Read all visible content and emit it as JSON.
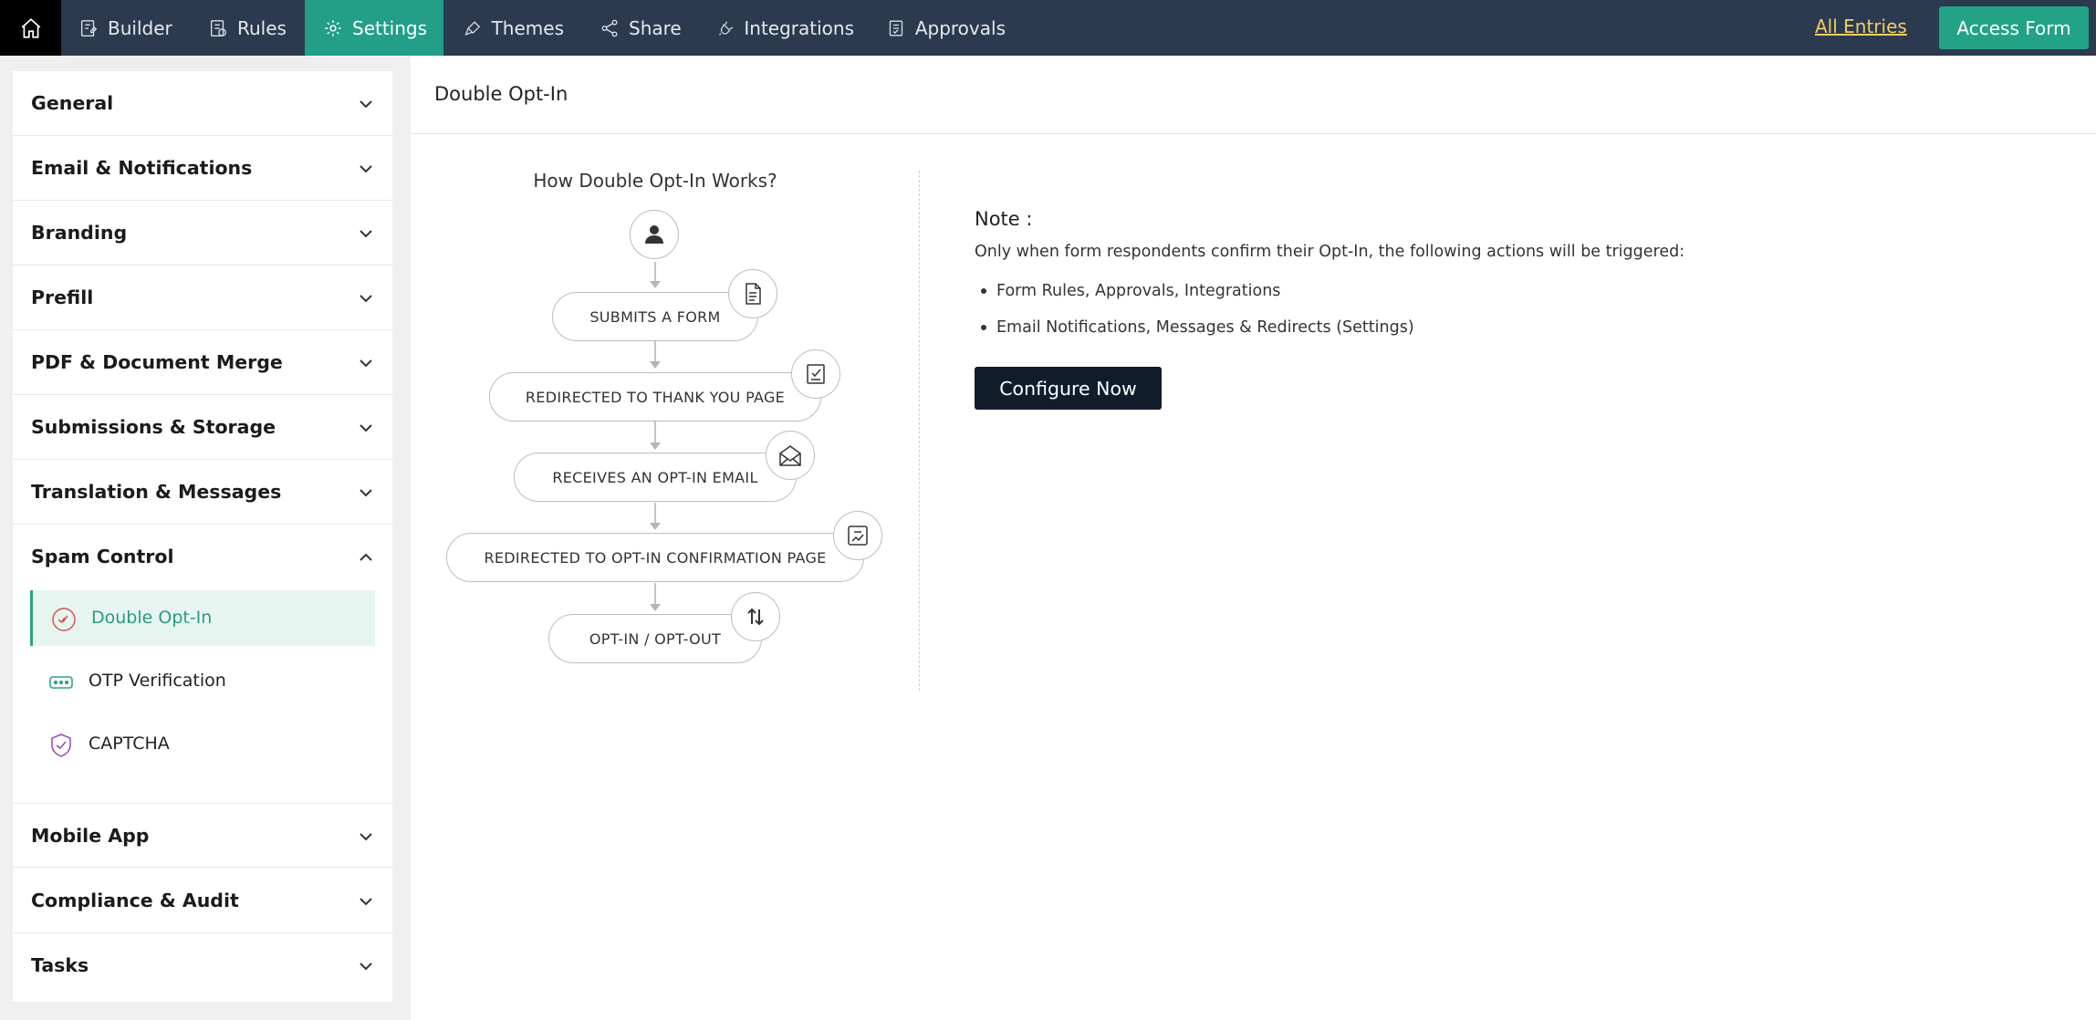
{
  "topbar": {
    "tabs": [
      {
        "label": "Builder",
        "icon": "builder-icon"
      },
      {
        "label": "Rules",
        "icon": "rules-icon"
      },
      {
        "label": "Settings",
        "icon": "gear-icon",
        "active": true
      },
      {
        "label": "Themes",
        "icon": "brush-icon"
      },
      {
        "label": "Share",
        "icon": "share-icon"
      },
      {
        "label": "Integrations",
        "icon": "plug-icon"
      },
      {
        "label": "Approvals",
        "icon": "approvals-icon"
      }
    ],
    "all_entries": "All Entries",
    "access_form": "Access Form"
  },
  "sidebar": {
    "sections": [
      {
        "label": "General"
      },
      {
        "label": "Email & Notifications"
      },
      {
        "label": "Branding"
      },
      {
        "label": "Prefill"
      },
      {
        "label": "PDF & Document Merge"
      },
      {
        "label": "Submissions & Storage"
      },
      {
        "label": "Translation & Messages"
      },
      {
        "label": "Spam Control",
        "expanded": true
      },
      {
        "label": "Mobile App"
      },
      {
        "label": "Compliance & Audit"
      },
      {
        "label": "Tasks"
      }
    ],
    "spam_items": [
      {
        "label": "Double Opt-In",
        "icon": "double-opt-in-icon",
        "active": true
      },
      {
        "label": "OTP Verification",
        "icon": "otp-icon"
      },
      {
        "label": "CAPTCHA",
        "icon": "captcha-icon"
      }
    ]
  },
  "main": {
    "title": "Double Opt-In",
    "how_title": "How Double Opt-In Works?",
    "steps": [
      {
        "label": "SUBMITS A FORM",
        "icon": "document-icon"
      },
      {
        "label": "REDIRECTED TO THANK YOU PAGE",
        "icon": "checklist-icon"
      },
      {
        "label": "RECEIVES AN OPT-IN EMAIL",
        "icon": "open-mail-icon"
      },
      {
        "label": "REDIRECTED TO OPT-IN CONFIRMATION PAGE",
        "icon": "confirm-page-icon"
      },
      {
        "label": "OPT-IN / OPT-OUT",
        "icon": "swap-arrows-icon"
      }
    ],
    "note_title": "Note :",
    "note_text": "Only when form respondents confirm their Opt-In, the following actions will be triggered:",
    "note_items": [
      "Form Rules, Approvals, Integrations",
      "Email Notifications, Messages & Redirects (Settings)"
    ],
    "configure_label": "Configure Now"
  },
  "colors": {
    "topbar": "#2b3a4e",
    "accent": "#229e89",
    "all_entries": "#f3cd63",
    "configure_button": "#111c2b"
  }
}
